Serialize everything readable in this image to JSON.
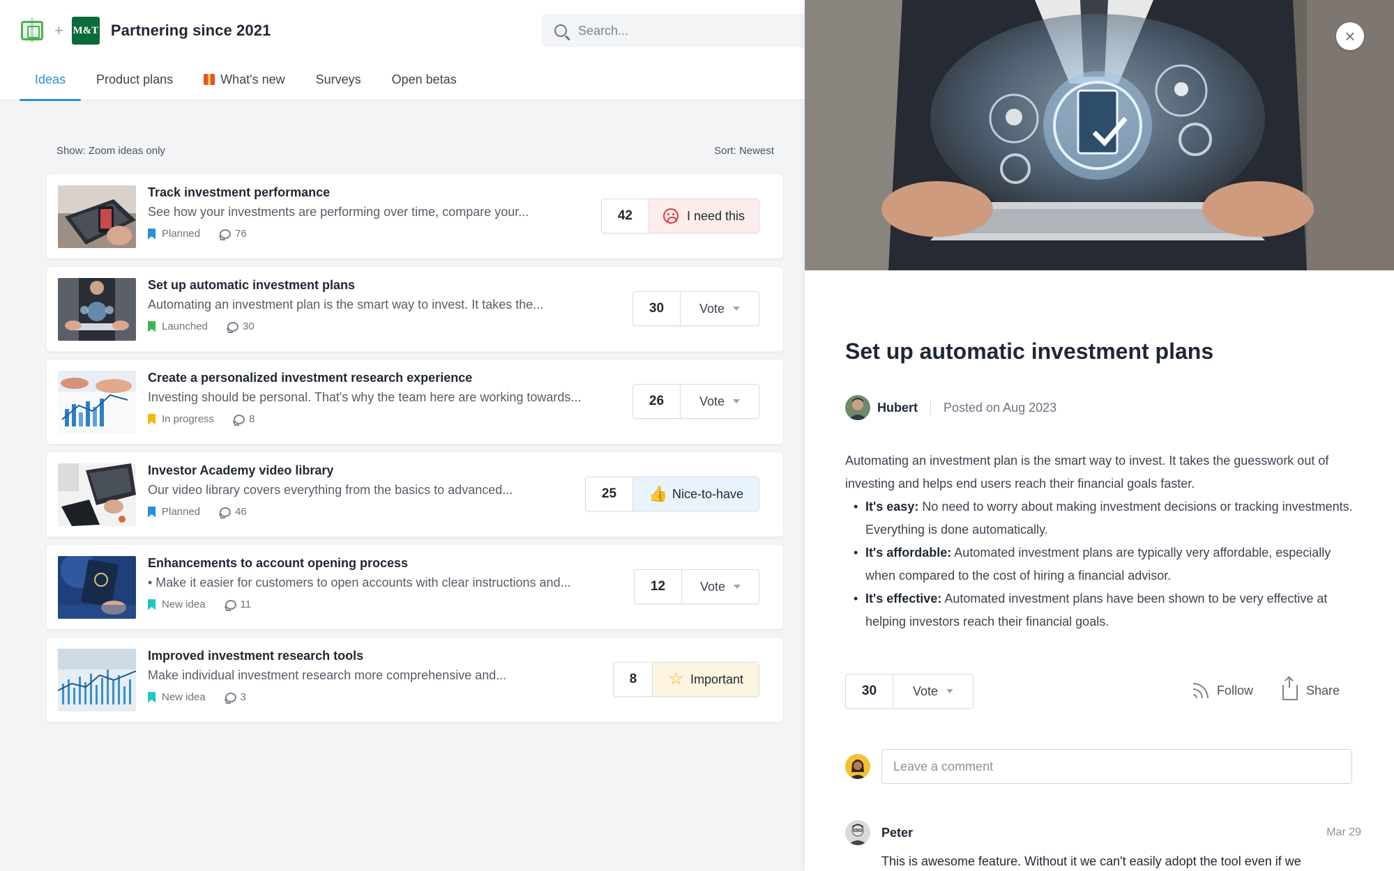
{
  "header": {
    "brand_title": "Partnering since 2021",
    "plus": "+",
    "logo_text": "M&T",
    "search_placeholder": "Search..."
  },
  "tabs": [
    {
      "label": "Ideas",
      "active": true
    },
    {
      "label": "Product plans"
    },
    {
      "label": "What's new",
      "icon": "gift-icon"
    },
    {
      "label": "Surveys"
    },
    {
      "label": "Open betas"
    }
  ],
  "filters": {
    "show": "Show: Zoom ideas only",
    "sort": "Sort: Newest"
  },
  "ideas": [
    {
      "title": "Track investment performance",
      "desc": "See how your investments are performing over time, compare your...",
      "status": "Planned",
      "status_color": "#2a8fd6",
      "comments": "76",
      "votes": "42",
      "vote_label": "I need this",
      "vote_style": "need"
    },
    {
      "title": "Set up automatic investment plans",
      "desc": "Automating an investment plan is the smart way to invest. It takes the...",
      "status": "Launched",
      "status_color": "#3fb54a",
      "comments": "30",
      "votes": "30",
      "vote_label": "Vote",
      "vote_style": "plain"
    },
    {
      "title": "Create a personalized investment research experience",
      "desc": "Investing should be personal. That's why the team here are working towards...",
      "status": "In progress",
      "status_color": "#f5b80f",
      "comments": "8",
      "votes": "26",
      "vote_label": "Vote",
      "vote_style": "plain"
    },
    {
      "title": "Investor Academy video library",
      "desc": "Our video library covers everything from the basics to advanced...",
      "status": "Planned",
      "status_color": "#2a8fd6",
      "comments": "46",
      "votes": "25",
      "vote_label": "Nice-to-have",
      "vote_style": "nice"
    },
    {
      "title": "Enhancements to account opening process",
      "desc": "•  Make it easier for customers to open accounts with clear instructions and...",
      "status": "New idea",
      "status_color": "#1ec8c0",
      "comments": "11",
      "votes": "12",
      "vote_label": "Vote",
      "vote_style": "plain"
    },
    {
      "title": "Improved investment research tools",
      "desc": "Make individual investment research more comprehensive and...",
      "status": "New idea",
      "status_color": "#1ec8c0",
      "comments": "3",
      "votes": "8",
      "vote_label": "Important",
      "vote_style": "imp"
    }
  ],
  "detail": {
    "close": "×",
    "title": "Set up automatic investment plans",
    "author": "Hubert",
    "posted": "Posted on Aug 2023",
    "intro": "Automating an investment plan is the smart way to invest. It takes the guesswork out of investing and helps end users reach their financial goals faster.",
    "bullets": [
      {
        "bold": "It's easy:",
        "text": " No need to worry about making investment decisions or tracking investments. Everything is done automatically."
      },
      {
        "bold": "It's affordable:",
        "text": " Automated investment plans are typically very affordable, especially when compared to the cost of hiring a financial advisor."
      },
      {
        "bold": "It's effective:",
        "text": " Automated investment plans have been shown to be very effective at helping investors reach their financial goals."
      }
    ],
    "votes": "30",
    "vote_label": "Vote",
    "follow": "Follow",
    "share": "Share",
    "comment_placeholder": "Leave a comment",
    "comment": {
      "name": "Peter",
      "date": "Mar 29",
      "text": "This is awesome feature. Without it we can't easily adopt the tool even if we"
    }
  }
}
